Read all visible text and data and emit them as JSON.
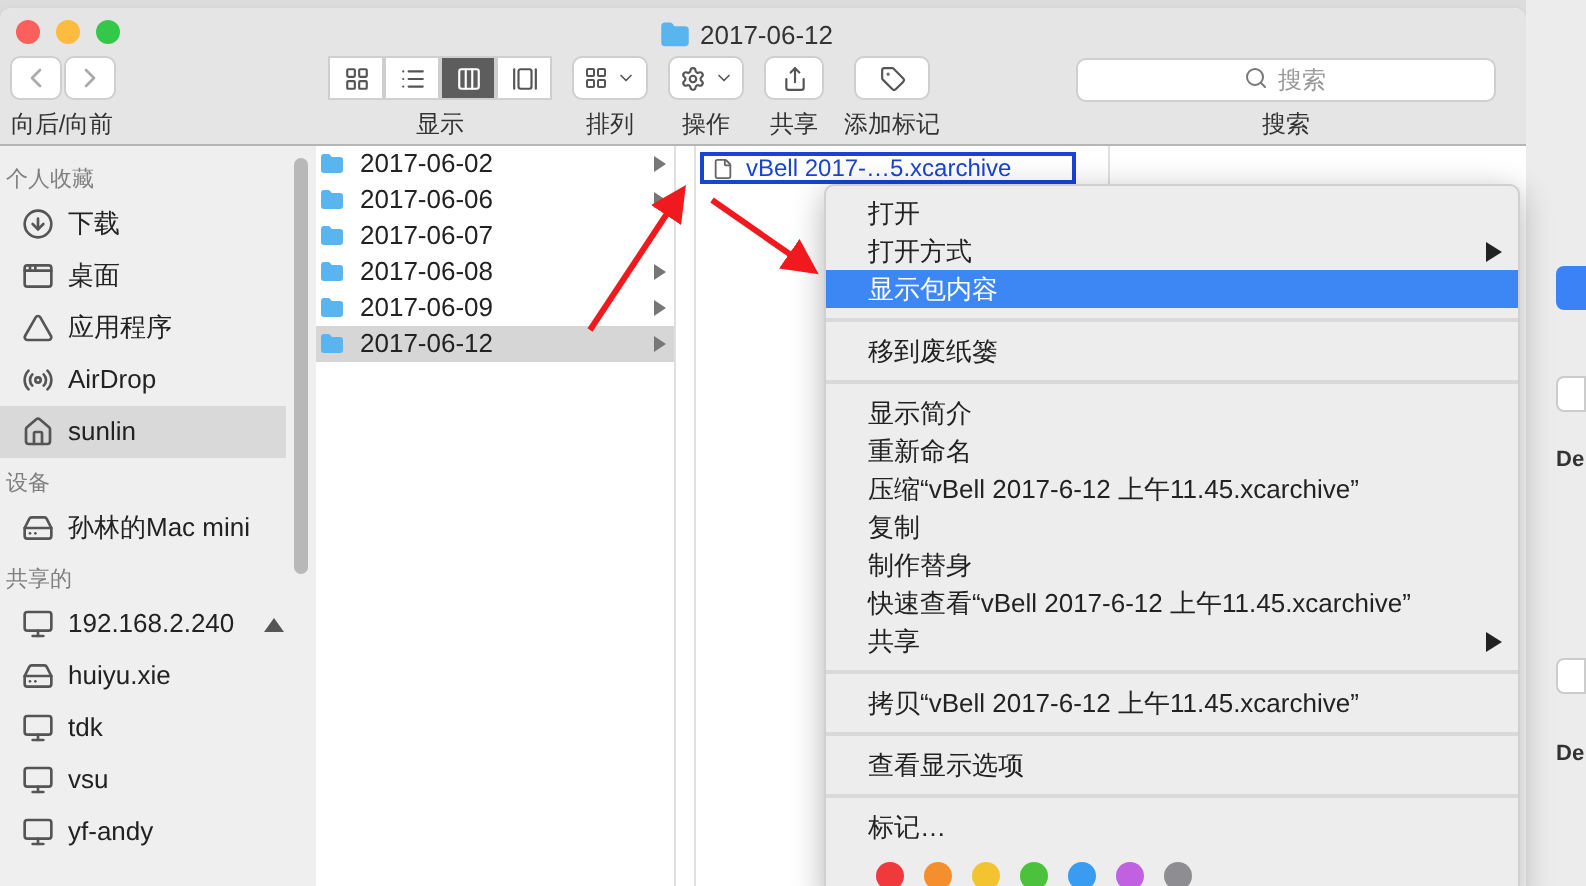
{
  "window": {
    "title": "2017-06-12"
  },
  "toolbar": {
    "nav": {
      "label": "向后/向前"
    },
    "view": {
      "label": "显示",
      "modes": [
        {
          "kind": "icons",
          "selected": false
        },
        {
          "kind": "list",
          "selected": false
        },
        {
          "kind": "columns",
          "selected": true
        },
        {
          "kind": "gallery",
          "selected": false
        }
      ]
    },
    "arrange": {
      "label": "排列"
    },
    "action": {
      "label": "操作"
    },
    "share": {
      "label": "共享"
    },
    "tags": {
      "label": "添加标记"
    },
    "search": {
      "placeholder": "搜索",
      "label": "搜索"
    }
  },
  "sidebar": {
    "sections": [
      {
        "title": "个人收藏",
        "items": [
          {
            "kind": "download",
            "label": "下载",
            "selected": false,
            "eject": false
          },
          {
            "kind": "desktop",
            "label": "桌面",
            "selected": false,
            "eject": false
          },
          {
            "kind": "apps",
            "label": "应用程序",
            "selected": false,
            "eject": false
          },
          {
            "kind": "airdrop",
            "label": "AirDrop",
            "selected": false,
            "eject": false
          },
          {
            "kind": "home",
            "label": "sunlin",
            "selected": true,
            "eject": false
          }
        ]
      },
      {
        "title": "设备",
        "items": [
          {
            "kind": "drive",
            "label": "孙林的Mac mini",
            "selected": false,
            "eject": false
          }
        ]
      },
      {
        "title": "共享的",
        "items": [
          {
            "kind": "monitor",
            "label": "192.168.2.240",
            "selected": false,
            "eject": true
          },
          {
            "kind": "drive",
            "label": "huiyu.xie",
            "selected": false,
            "eject": false
          },
          {
            "kind": "monitor",
            "label": "tdk",
            "selected": false,
            "eject": false
          },
          {
            "kind": "monitor",
            "label": "vsu",
            "selected": false,
            "eject": false
          },
          {
            "kind": "monitor",
            "label": "yf-andy",
            "selected": false,
            "eject": false
          }
        ]
      }
    ]
  },
  "column_1": [
    {
      "name": "2017-06-02",
      "selected": false,
      "expandable": true
    },
    {
      "name": "2017-06-06",
      "selected": false,
      "expandable": true
    },
    {
      "name": "2017-06-07",
      "selected": false,
      "expandable": false
    },
    {
      "name": "2017-06-08",
      "selected": false,
      "expandable": true
    },
    {
      "name": "2017-06-09",
      "selected": false,
      "expandable": true
    },
    {
      "name": "2017-06-12",
      "selected": true,
      "expandable": true
    }
  ],
  "column_2": [
    {
      "name": "vBell 2017-…5.xcarchive",
      "selected": true
    }
  ],
  "context_menu": [
    {
      "kind": "item",
      "label": "打开",
      "selected": false,
      "submenu": false
    },
    {
      "kind": "item",
      "label": "打开方式",
      "selected": false,
      "submenu": true
    },
    {
      "kind": "item",
      "label": "显示包内容",
      "selected": true,
      "submenu": false
    },
    {
      "kind": "separator"
    },
    {
      "kind": "item",
      "label": "移到废纸篓",
      "selected": false,
      "submenu": false
    },
    {
      "kind": "separator"
    },
    {
      "kind": "item",
      "label": "显示简介",
      "selected": false,
      "submenu": false
    },
    {
      "kind": "item",
      "label": "重新命名",
      "selected": false,
      "submenu": false
    },
    {
      "kind": "item",
      "label": "压缩“vBell 2017-6-12 上午11.45.xcarchive”",
      "selected": false,
      "submenu": false
    },
    {
      "kind": "item",
      "label": "复制",
      "selected": false,
      "submenu": false
    },
    {
      "kind": "item",
      "label": "制作替身",
      "selected": false,
      "submenu": false
    },
    {
      "kind": "item",
      "label": "快速查看“vBell 2017-6-12 上午11.45.xcarchive”",
      "selected": false,
      "submenu": false
    },
    {
      "kind": "item",
      "label": "共享",
      "selected": false,
      "submenu": true
    },
    {
      "kind": "separator"
    },
    {
      "kind": "item",
      "label": "拷贝“vBell 2017-6-12 上午11.45.xcarchive”",
      "selected": false,
      "submenu": false
    },
    {
      "kind": "separator"
    },
    {
      "kind": "item",
      "label": "查看显示选项",
      "selected": false,
      "submenu": false
    },
    {
      "kind": "separator"
    },
    {
      "kind": "item",
      "label": "标记…",
      "selected": false,
      "submenu": false
    },
    {
      "kind": "colors",
      "colors": [
        {
          "color": "#f0393c"
        },
        {
          "color": "#f58f2e"
        },
        {
          "color": "#f4c430"
        },
        {
          "color": "#4cc23c"
        },
        {
          "color": "#3a9cf0"
        },
        {
          "color": "#c160e0"
        },
        {
          "color": "#8e8e92"
        }
      ]
    }
  ],
  "background_window": {
    "labels": [
      "De",
      "De"
    ]
  }
}
